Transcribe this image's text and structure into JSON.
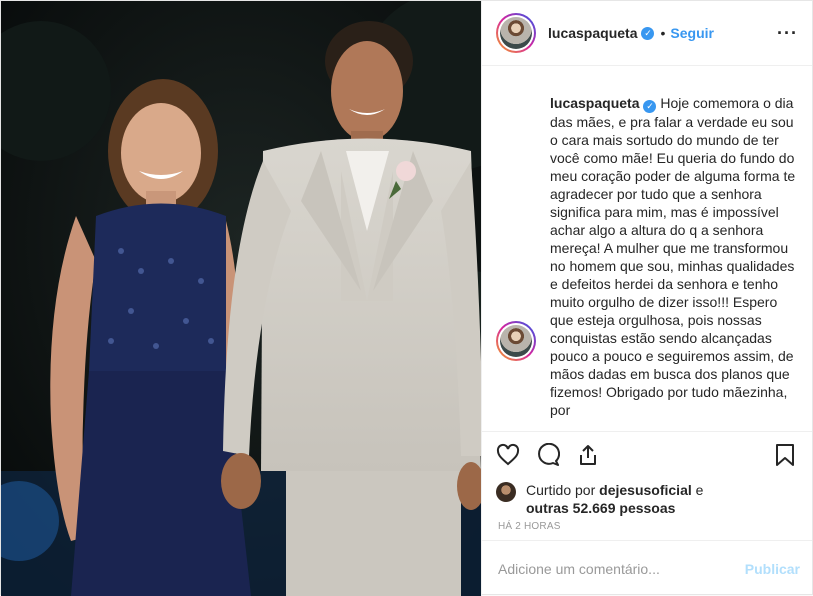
{
  "header": {
    "username": "lucaspaqueta",
    "verified_glyph": "✓",
    "separator": "•",
    "follow_label": "Seguir",
    "more_label": "···",
    "avatar_icon": "profile-avatar"
  },
  "caption": {
    "username": "lucaspaqueta",
    "verified_glyph": "✓",
    "text": "Hoje comemora o dia das mães, e pra falar a verdade eu sou o cara mais sortudo do mundo de ter você como mãe! Eu queria do fundo do meu coração poder de alguma forma te agradecer por tudo que a senhora significa para mim, mas é impossível achar algo a altura do q a senhora mereça! A mulher que me transformou no homem que sou, minhas qualidades e defeitos herdei da senhora e tenho muito orgulho de dizer isso!!! Espero que esteja orgulhosa, pois nossas conquistas estão sendo alcançadas pouco a pouco e seguiremos assim, de mãos dadas em busca dos planos que fizemos! Obrigado por tudo mãezinha, por"
  },
  "actions": {
    "like_icon": "heart-icon",
    "comment_icon": "comment-icon",
    "share_icon": "share-icon",
    "save_icon": "bookmark-icon"
  },
  "likes": {
    "prefix": "Curtido por ",
    "user": "dejesusoficial",
    "middle": " e",
    "others": "outras 52.669 pessoas"
  },
  "timestamp": "HÁ 2 HORAS",
  "comment_box": {
    "placeholder": "Adicione um comentário...",
    "publish_label": "Publicar"
  }
}
